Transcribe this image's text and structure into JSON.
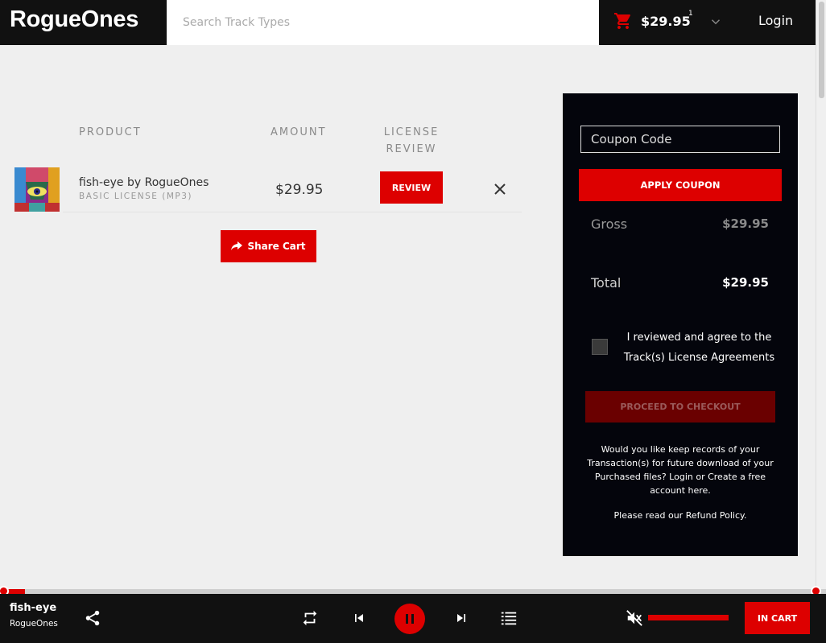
{
  "header": {
    "logo": "RogueOnes",
    "search_placeholder": "Search Track Types",
    "cart_total": "$29.95",
    "cart_count": "1",
    "login": "Login"
  },
  "cart": {
    "columns": {
      "product": "PRODUCT",
      "amount": "AMOUNT",
      "license_line1": "LICENSE",
      "license_line2": "REVIEW"
    },
    "items": [
      {
        "name": "fish-eye by RogueOnes",
        "license": "BASIC LICENSE (MP3)",
        "amount": "$29.95",
        "review_label": "REVIEW"
      }
    ],
    "share_label": "Share Cart"
  },
  "summary": {
    "coupon_placeholder": "Coupon Code",
    "apply_label": "APPLY COUPON",
    "gross_label": "Gross",
    "gross_value": "$29.95",
    "total_label": "Total",
    "total_value": "$29.95",
    "agree_text": "I reviewed and agree to the Track(s) License Agreements",
    "checkout_label": "PROCEED TO CHECKOUT",
    "records_note": "Would you like keep records of your Transaction(s) for future download of your Purchased files? Login or Create a free account here.",
    "refund_note": "Please read our Refund Policy."
  },
  "player": {
    "title": "fish-eye",
    "artist": "RogueOnes",
    "progress_fraction": 0.03,
    "muted": true,
    "in_cart_label": "IN CART"
  },
  "colors": {
    "accent": "#dd0000",
    "dark": "#111111",
    "panel": "#04050c"
  }
}
